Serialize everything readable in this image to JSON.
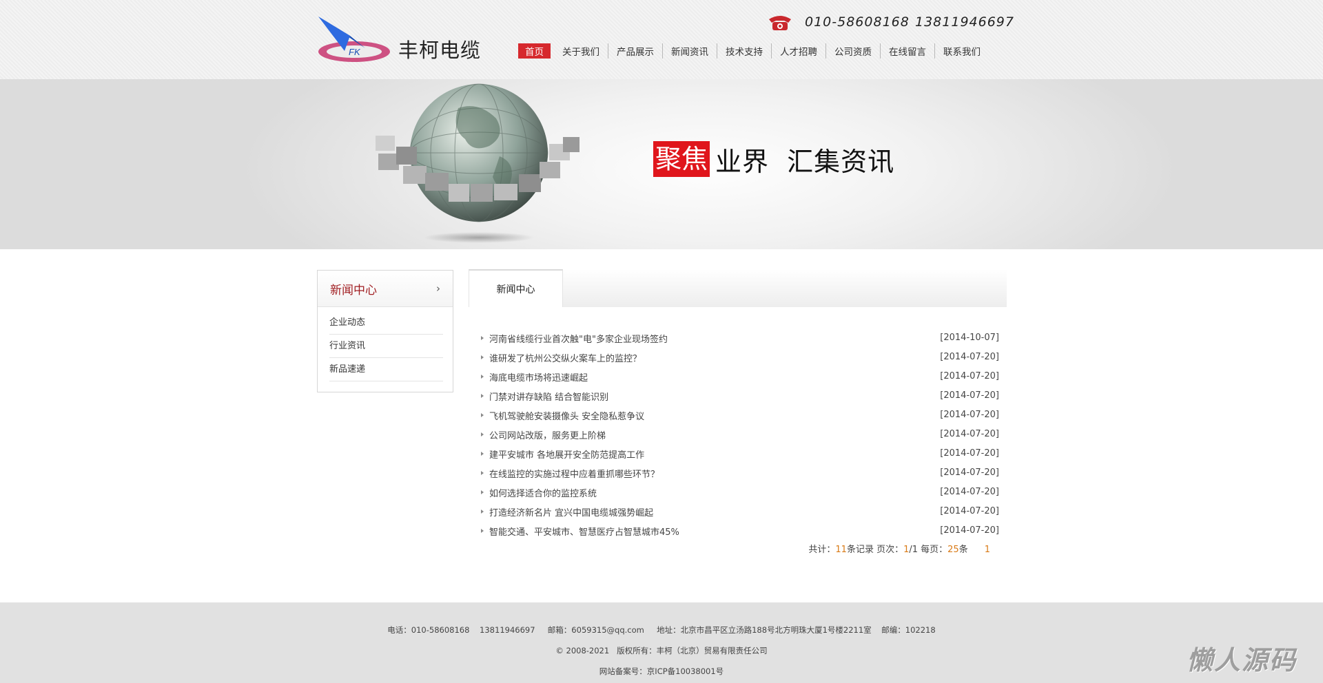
{
  "header": {
    "brand_name": "丰柯电缆",
    "logo_letters": "FK",
    "phone1": "010-58608168",
    "phone2": "13811946697",
    "nav": [
      {
        "label": "首页",
        "active": true
      },
      {
        "label": "关于我们"
      },
      {
        "label": "产品展示"
      },
      {
        "label": "新闻资讯"
      },
      {
        "label": "技术支持"
      },
      {
        "label": "人才招聘"
      },
      {
        "label": "公司资质"
      },
      {
        "label": "在线留言"
      },
      {
        "label": "联系我们"
      }
    ]
  },
  "banner": {
    "slogan_highlight": "聚焦",
    "slogan_rest": "业界  汇集资讯"
  },
  "sidebar": {
    "title": "新闻中心",
    "arrow": "›",
    "items": [
      {
        "label": "企业动态"
      },
      {
        "label": "行业资讯"
      },
      {
        "label": "新品速递"
      }
    ]
  },
  "main": {
    "tab_label": "新闻中心",
    "news": [
      {
        "title": "河南省线缆行业首次触\"电\"多家企业现场签约",
        "date": "[2014-10-07]"
      },
      {
        "title": "谁研发了杭州公交纵火案车上的监控？",
        "date": "[2014-07-20]"
      },
      {
        "title": "海底电缆市场将迅速崛起",
        "date": "[2014-07-20]"
      },
      {
        "title": "门禁对讲存缺陷 结合智能识别",
        "date": "[2014-07-20]"
      },
      {
        "title": "飞机驾驶舱安装摄像头 安全隐私惹争议",
        "date": "[2014-07-20]"
      },
      {
        "title": "公司网站改版，服务更上阶梯",
        "date": "[2014-07-20]"
      },
      {
        "title": "建平安城市 各地展开安全防范提高工作",
        "date": "[2014-07-20]"
      },
      {
        "title": "在线监控的实施过程中应着重抓哪些环节？",
        "date": "[2014-07-20]"
      },
      {
        "title": "如何选择适合你的监控系统",
        "date": "[2014-07-20]"
      },
      {
        "title": "打造经济新名片 宜兴中国电缆城强势崛起",
        "date": "[2014-07-20]"
      },
      {
        "title": "智能交通、平安城市、智慧医疗占智慧城市45%",
        "date": "[2014-07-20]"
      }
    ],
    "pager": {
      "total_label": "共计：",
      "total": "11",
      "records_label": "条记录 页次：",
      "page": "1",
      "pages": "/1",
      "per_page_label": " 每页：",
      "per_page": "25",
      "unit": "条",
      "page_link": "1"
    }
  },
  "footer": {
    "line1": "电话：010-58608168    13811946697     邮箱：6059315@qq.com     地址：北京市昌平区立汤路188号北方明珠大厦1号楼2211室    邮编：102218",
    "line2": "© 2008-2021   版权所有：丰柯（北京）贸易有限责任公司",
    "line3": "网站备案号：京ICP备10038001号",
    "watermark": "懒人源码"
  },
  "colors": {
    "accent_red": "#d6282d",
    "banner_red": "#e0161c",
    "sidebar_title": "#a11e22",
    "pager_orange": "#d97a16"
  }
}
